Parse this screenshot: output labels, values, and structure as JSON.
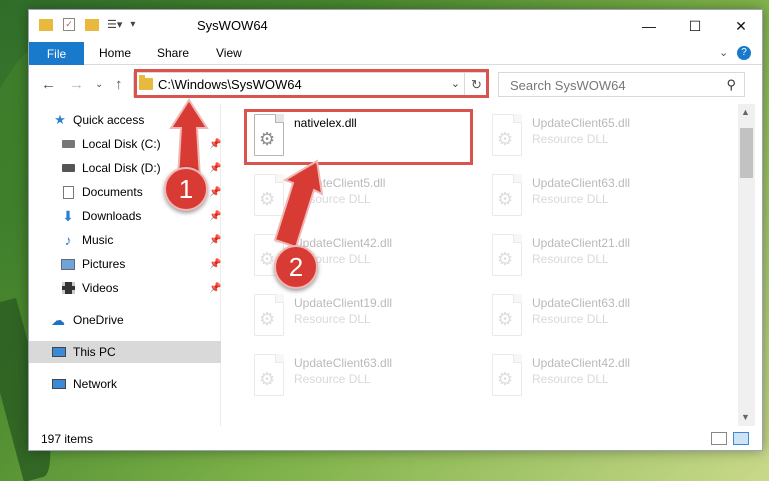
{
  "window": {
    "title": "SysWOW64"
  },
  "ribbon": {
    "tabs": [
      "File",
      "Home",
      "Share",
      "View"
    ]
  },
  "address": {
    "path": "C:\\Windows\\SysWOW64",
    "search_placeholder": "Search SysWOW64"
  },
  "sidebar": {
    "items": [
      {
        "label": "Quick access",
        "icon": "star-icon"
      },
      {
        "label": "Local Disk (C:)",
        "icon": "drive-icon"
      },
      {
        "label": "Local Disk (D:)",
        "icon": "drive-icon"
      },
      {
        "label": "Documents",
        "icon": "documents-icon"
      },
      {
        "label": "Downloads",
        "icon": "download-icon"
      },
      {
        "label": "Music",
        "icon": "music-icon"
      },
      {
        "label": "Pictures",
        "icon": "pictures-icon"
      },
      {
        "label": "Videos",
        "icon": "videos-icon"
      },
      {
        "label": "OneDrive",
        "icon": "cloud-icon"
      },
      {
        "label": "This PC",
        "icon": "computer-icon"
      },
      {
        "label": "Network",
        "icon": "network-icon"
      }
    ]
  },
  "files": [
    {
      "name": "nativelex.dll",
      "type": ""
    },
    {
      "name": "UpdateClient65.dll",
      "type": "Resource DLL"
    },
    {
      "name": "UpdateClient5.dll",
      "type": "Resource DLL"
    },
    {
      "name": "UpdateClient63.dll",
      "type": "Resource DLL"
    },
    {
      "name": "UpdateClient42.dll",
      "type": "Resource DLL"
    },
    {
      "name": "UpdateClient21.dll",
      "type": "Resource DLL"
    },
    {
      "name": "UpdateClient19.dll",
      "type": "Resource DLL"
    },
    {
      "name": "UpdateClient63.dll",
      "type": "Resource DLL"
    },
    {
      "name": "UpdateClient63.dll",
      "type": "Resource DLL"
    },
    {
      "name": "UpdateClient42.dll",
      "type": "Resource DLL"
    }
  ],
  "status": {
    "item_count": "197 items"
  },
  "callouts": [
    "1",
    "2"
  ],
  "colors": {
    "accent": "#1979ca",
    "highlight_box": "#d9534f",
    "badge": "#d83a34"
  }
}
